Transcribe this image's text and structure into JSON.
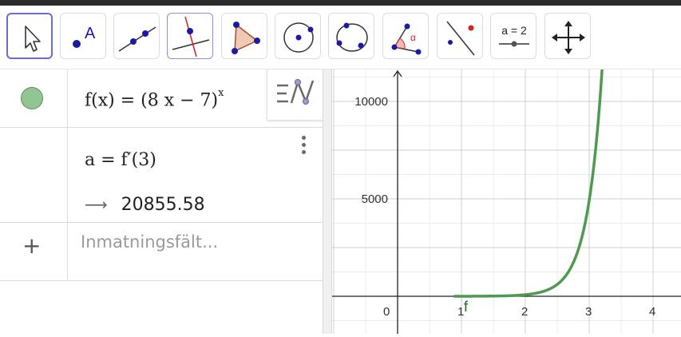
{
  "toolbar": {
    "tools": [
      {
        "name": "move-tool",
        "icon": "cursor-arrow-icon",
        "selected": true
      },
      {
        "name": "point-tool",
        "icon": "point-icon",
        "label": "A"
      },
      {
        "name": "line-tool",
        "icon": "line-icon"
      },
      {
        "name": "perpendicular-line-tool",
        "icon": "perpendicular-line-icon"
      },
      {
        "name": "polygon-tool",
        "icon": "polygon-icon"
      },
      {
        "name": "circle-center-point-tool",
        "icon": "circle-icon"
      },
      {
        "name": "circle-three-points-tool",
        "icon": "circle-three-points-icon"
      },
      {
        "name": "angle-tool",
        "icon": "angle-icon",
        "label": "α"
      },
      {
        "name": "reflect-tool",
        "icon": "reflect-icon"
      },
      {
        "name": "slider-tool",
        "icon": "slider-icon",
        "label": "a = 2"
      },
      {
        "name": "move-graphics-view-tool",
        "icon": "move-arrows-icon"
      }
    ]
  },
  "algebra": {
    "rows": [
      {
        "expression": "f(x) = (8 x − 7)",
        "exponent": "x",
        "color": "#93c493"
      },
      {
        "expression": "a = f′(3)",
        "result_arrow": "⟶",
        "result": "20855.58"
      }
    ],
    "input_placeholder": "Inmatningsfält...",
    "add_symbol": "+"
  },
  "graph": {
    "function_label": "f",
    "function_color": "#4e9a4e",
    "x_ticks": [
      "0",
      "1",
      "2",
      "3",
      "4"
    ],
    "y_ticks": [
      "5000",
      "10000"
    ],
    "grid": true
  }
}
